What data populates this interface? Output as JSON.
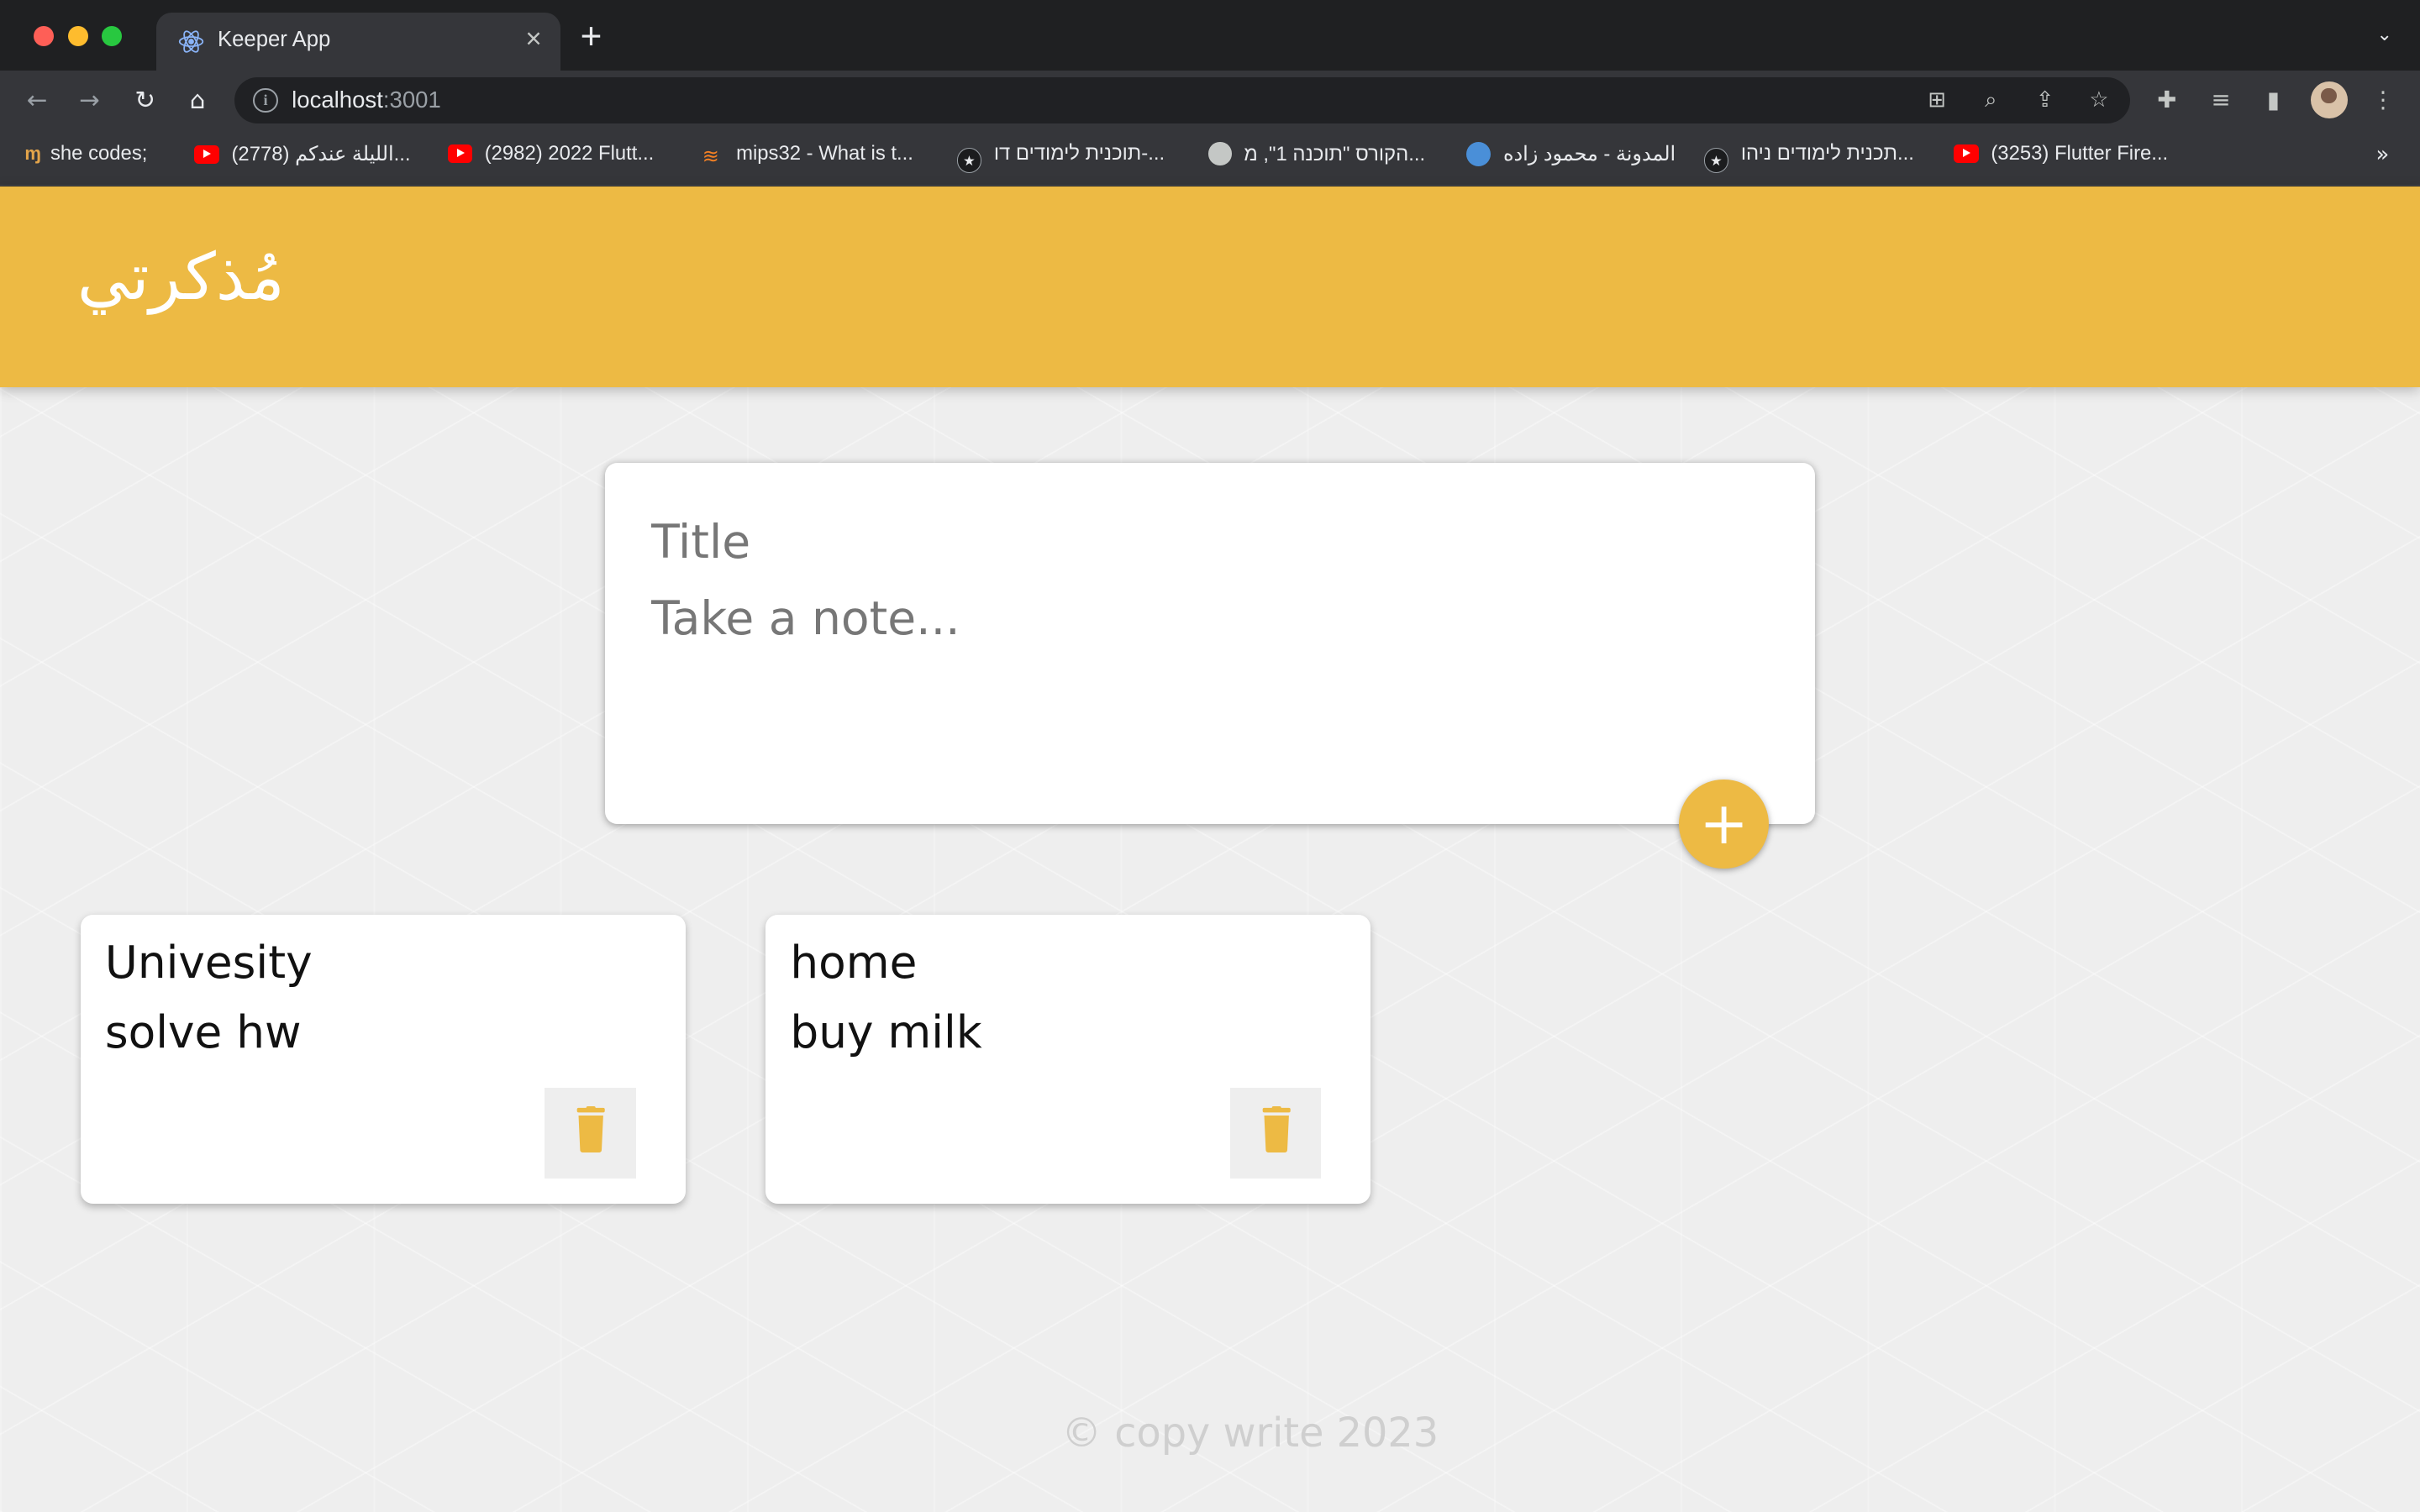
{
  "browser": {
    "tab_title": "Keeper App",
    "tab_favicon": "react-icon",
    "url_host": "localhost",
    "url_port": ":3001",
    "bookmarks": [
      {
        "label": "she codes;",
        "icon": "she-codes-icon"
      },
      {
        "label": "(2778) الليلة عندكم...",
        "icon": "youtube-icon"
      },
      {
        "label": "(2982) 2022 Flutt...",
        "icon": "youtube-icon"
      },
      {
        "label": "mips32 - What is t...",
        "icon": "stackoverflow-icon"
      },
      {
        "label": "תוכנית לימודים דו-...",
        "icon": "star-icon"
      },
      {
        "label": "הקורס \"תוכנה 1\", מ...",
        "icon": "globe-icon"
      },
      {
        "label": "المدونة - محمود زاده",
        "icon": "person-icon"
      },
      {
        "label": "תכנית לימודים ניהו...",
        "icon": "star-icon"
      },
      {
        "label": "(3253) Flutter Fire...",
        "icon": "youtube-icon"
      }
    ],
    "bookmarks_more": "»"
  },
  "header": {
    "title": "مُذكرتي"
  },
  "create_note": {
    "title_placeholder": "Title",
    "content_placeholder": "Take a note...",
    "add_label": "+"
  },
  "notes": [
    {
      "title": "Univesity",
      "content": "solve hw"
    },
    {
      "title": "home",
      "content": "buy milk"
    }
  ],
  "footer": {
    "text": "© copy write 2023"
  },
  "colors": {
    "accent": "#edba44",
    "header_text": "#ffffff",
    "page_background": "#eeeeee"
  }
}
